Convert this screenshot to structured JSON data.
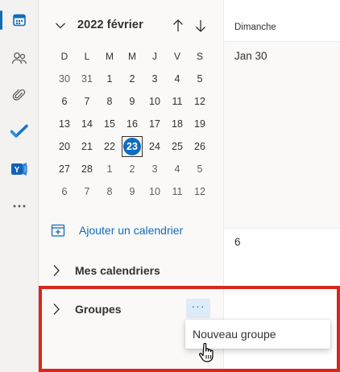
{
  "rail": {
    "items": [
      {
        "name": "calendar-icon",
        "active": true
      },
      {
        "name": "people-icon",
        "active": false
      },
      {
        "name": "attachment-icon",
        "active": false
      },
      {
        "name": "todo-icon",
        "active": false
      },
      {
        "name": "yammer-icon",
        "active": false
      },
      {
        "name": "more-apps-icon",
        "active": false
      }
    ]
  },
  "mini_calendar": {
    "title": "2022 février",
    "weekdays": [
      "D",
      "L",
      "M",
      "M",
      "J",
      "V",
      "S"
    ],
    "weeks": [
      [
        "30",
        "31",
        "1",
        "2",
        "3",
        "4",
        "5"
      ],
      [
        "6",
        "7",
        "8",
        "9",
        "10",
        "11",
        "12"
      ],
      [
        "13",
        "14",
        "15",
        "16",
        "17",
        "18",
        "19"
      ],
      [
        "20",
        "21",
        "22",
        "23",
        "24",
        "25",
        "26"
      ],
      [
        "27",
        "28",
        "1",
        "2",
        "3",
        "4",
        "5"
      ],
      [
        "6",
        "7",
        "8",
        "9",
        "10",
        "11",
        "12"
      ]
    ],
    "today": "23"
  },
  "sidebar": {
    "add_calendar": "Ajouter un calendrier",
    "my_calendars": "Mes calendriers",
    "groups": "Groupes",
    "more": "···"
  },
  "main": {
    "day_name": "Dimanche",
    "date_1": "Jan 30",
    "date_2": "6"
  },
  "context_menu": {
    "new_group": "Nouveau groupe"
  },
  "colors": {
    "accent": "#0f6cbd",
    "highlight": "#d9261c"
  }
}
